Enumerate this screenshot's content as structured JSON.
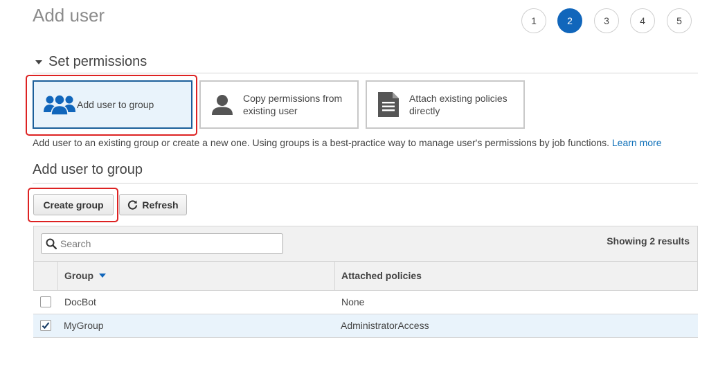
{
  "header": {
    "title": "Add user",
    "steps": [
      "1",
      "2",
      "3",
      "4",
      "5"
    ],
    "active_step": 2
  },
  "permissions": {
    "section_title": "Set permissions",
    "options": [
      {
        "label": "Add user to group",
        "icon": "users-group-icon",
        "selected": true
      },
      {
        "label_line1": "Copy permissions from",
        "label_line2": "existing user",
        "icon": "user-icon",
        "selected": false
      },
      {
        "label_line1": "Attach existing policies",
        "label_line2": "directly",
        "icon": "document-icon",
        "selected": false
      }
    ],
    "description": "Add user to an existing group or create a new one. Using groups is a best-practice way to manage user's permissions by job functions.",
    "learn_more": "Learn more"
  },
  "group_section": {
    "title": "Add user to group",
    "create_group_label": "Create group",
    "refresh_label": "Refresh"
  },
  "table": {
    "search_placeholder": "Search",
    "results_text": "Showing 2 results",
    "columns": [
      "Group",
      "Attached policies"
    ],
    "rows": [
      {
        "group": "DocBot",
        "policies": "None",
        "checked": false
      },
      {
        "group": "MyGroup",
        "policies": "AdministratorAccess",
        "checked": true
      }
    ]
  },
  "colors": {
    "accent": "#1166bb",
    "link": "#0d6fb8",
    "selected_bg": "#e9f3fb",
    "highlight": "#dd2222"
  }
}
